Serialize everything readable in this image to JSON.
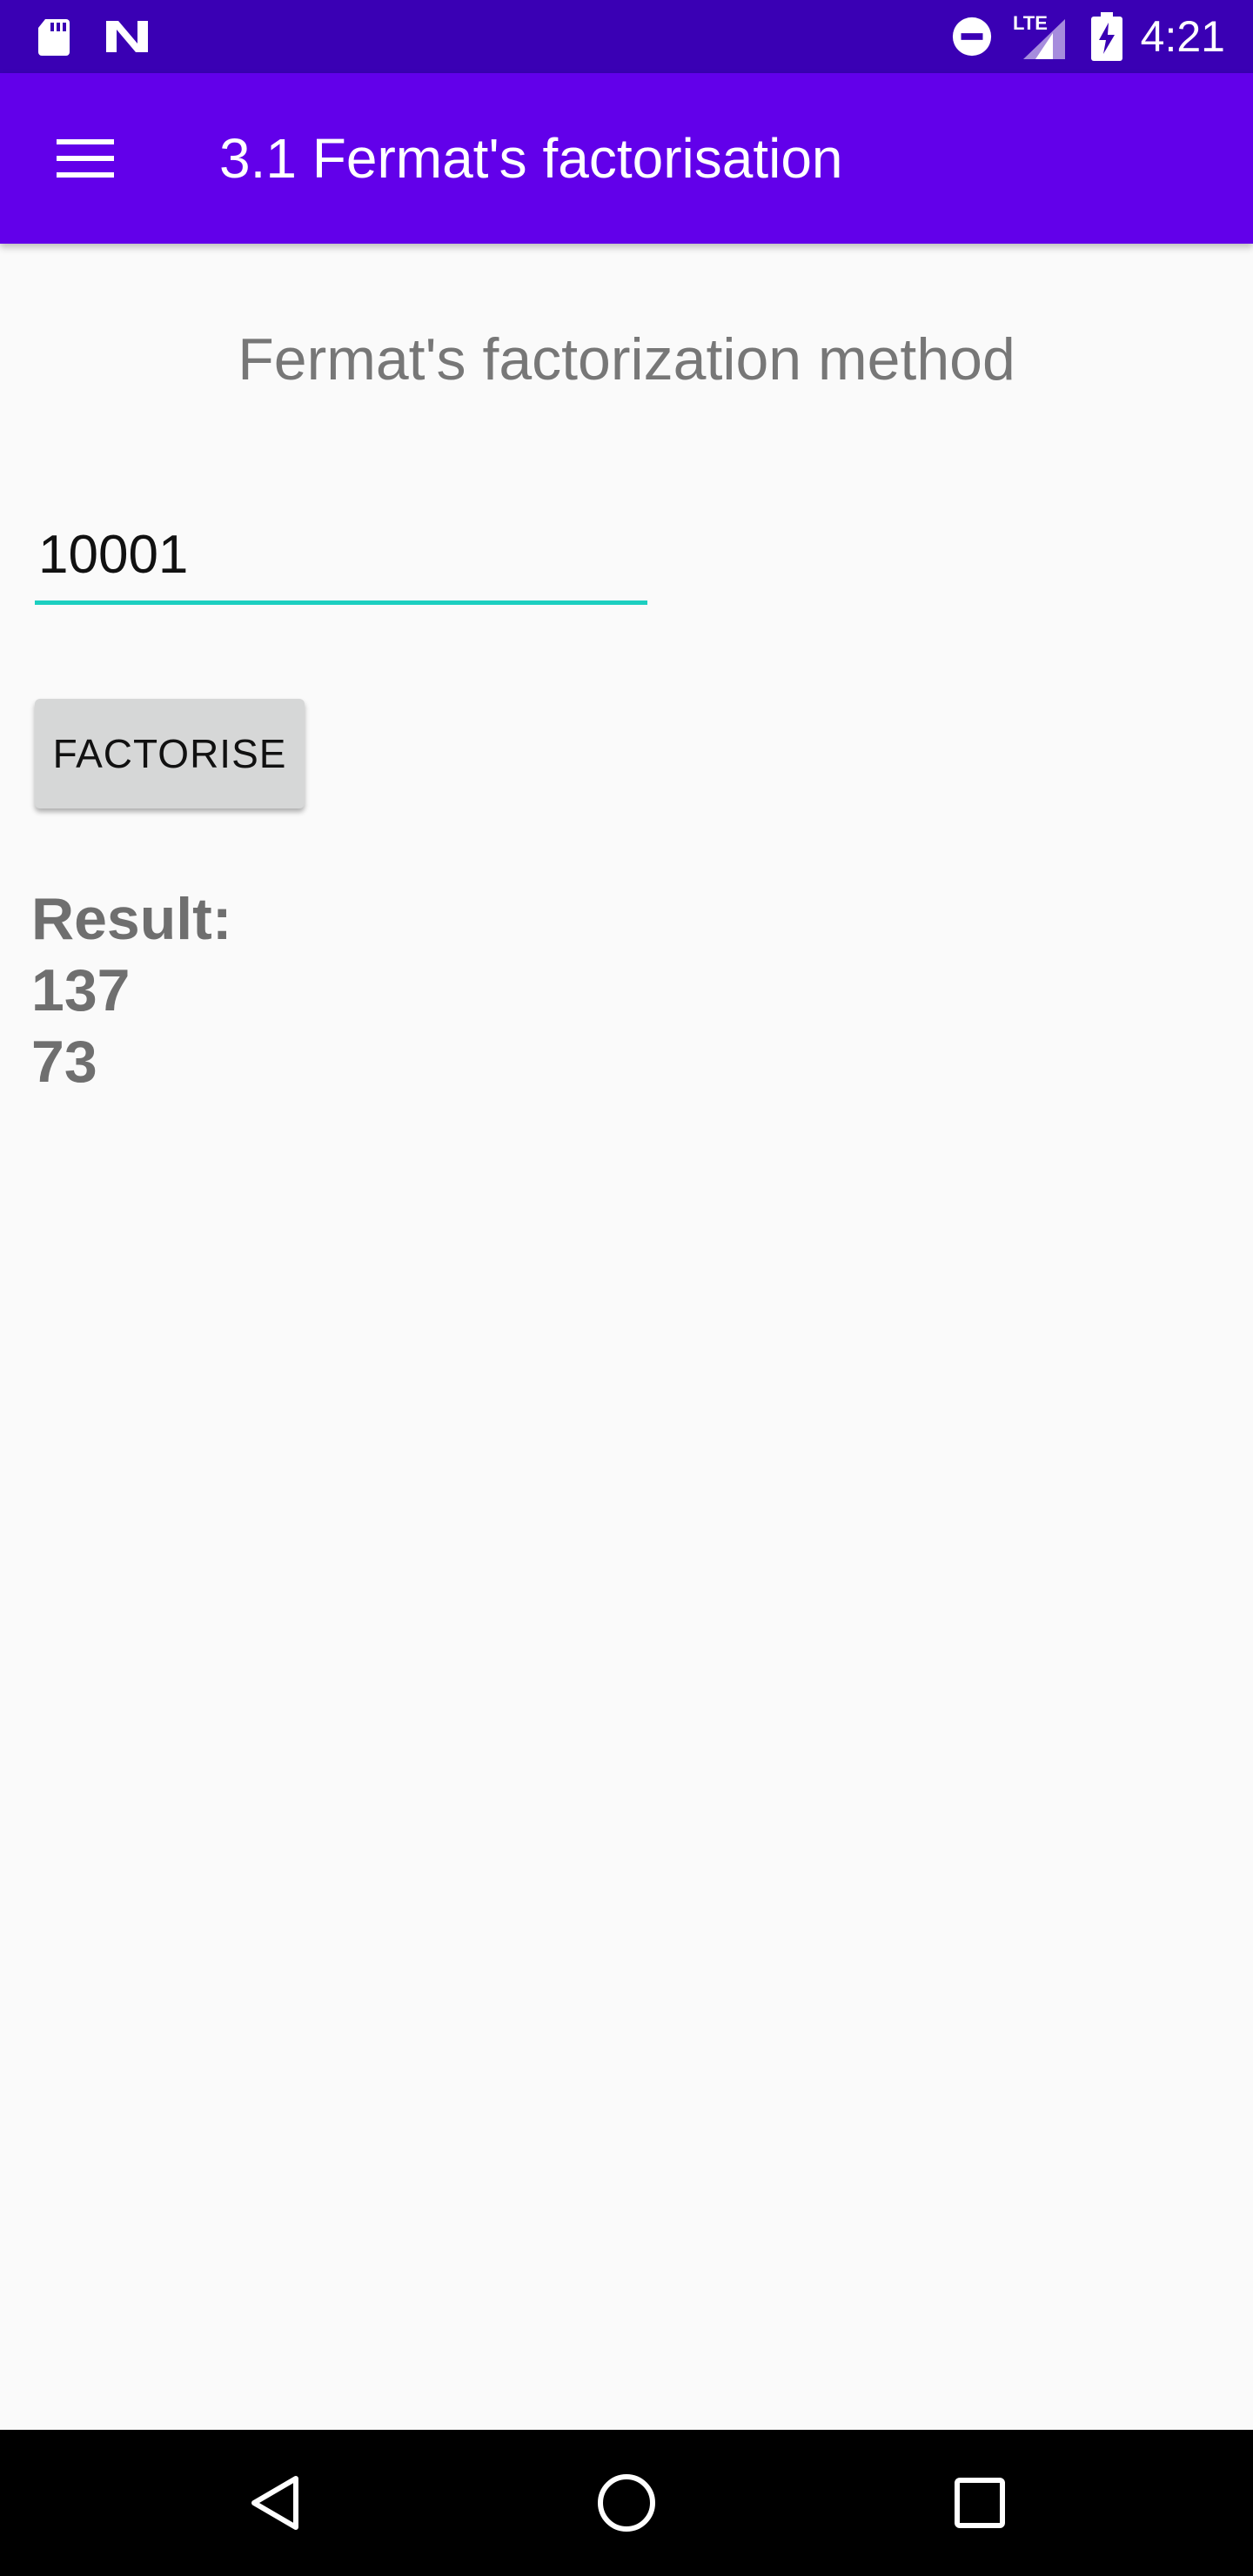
{
  "status_bar": {
    "time": "4:21",
    "network_label": "LTE",
    "icons": [
      "sd-card-icon",
      "n-notification-icon",
      "do-not-disturb-icon",
      "lte-signal-icon",
      "battery-charging-icon"
    ]
  },
  "app_bar": {
    "title": "3.1 Fermat's factorisation",
    "menu_icon": "hamburger-menu-icon",
    "color": "#6200ea"
  },
  "main": {
    "heading": "Fermat's factorization method",
    "input_value": "10001",
    "button_label": "FACTORISE",
    "result_label": "Result:",
    "results": [
      "137",
      "73"
    ]
  },
  "nav_bar": {
    "icons": [
      "back-icon",
      "home-icon",
      "recents-icon"
    ]
  },
  "colors": {
    "status_bar": "#3a00b4",
    "accent": "#1ccfc0",
    "background": "#fafafa"
  }
}
